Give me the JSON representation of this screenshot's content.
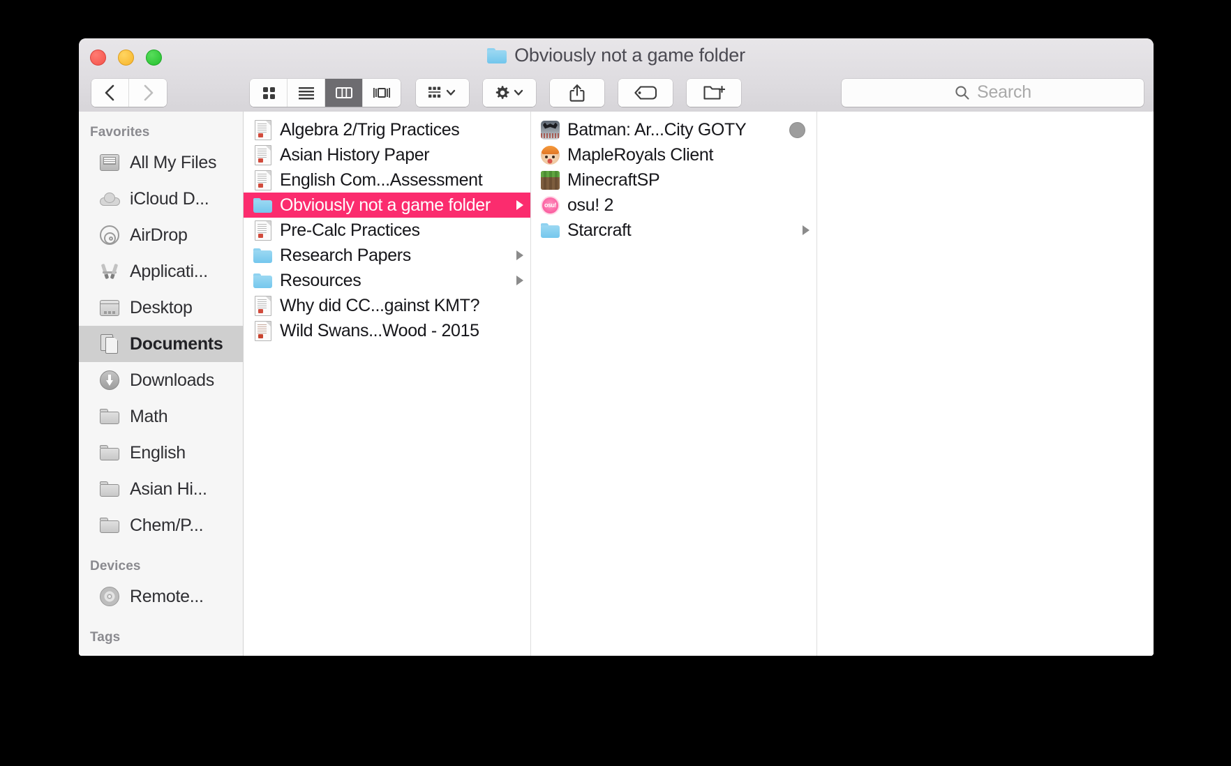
{
  "window": {
    "title": "Obviously not a game folder",
    "traffic_lights": [
      "close",
      "minimize",
      "maximize"
    ]
  },
  "toolbar": {
    "back_label": "Back",
    "forward_label": "Forward",
    "views": [
      {
        "name": "icon-view",
        "label": "Icon View",
        "active": false
      },
      {
        "name": "list-view",
        "label": "List View",
        "active": false
      },
      {
        "name": "column-view",
        "label": "Column View",
        "active": true
      },
      {
        "name": "coverflow-view",
        "label": "Cover Flow View",
        "active": false
      }
    ],
    "arrange_label": "Arrange",
    "action_label": "Action",
    "share_label": "Share",
    "tag_label": "Tag",
    "new_folder_label": "New Folder"
  },
  "search": {
    "placeholder": "Search",
    "value": ""
  },
  "sidebar": {
    "sections": [
      {
        "header": "Favorites",
        "items": [
          {
            "label": "All My Files",
            "icon": "all-my-files-icon",
            "selected": false
          },
          {
            "label": "iCloud D...",
            "icon": "icloud-drive-icon",
            "selected": false
          },
          {
            "label": "AirDrop",
            "icon": "airdrop-icon",
            "selected": false
          },
          {
            "label": "Applicati...",
            "icon": "applications-icon",
            "selected": false
          },
          {
            "label": "Desktop",
            "icon": "desktop-icon",
            "selected": false
          },
          {
            "label": "Documents",
            "icon": "documents-icon",
            "selected": true
          },
          {
            "label": "Downloads",
            "icon": "downloads-icon",
            "selected": false
          },
          {
            "label": "Math",
            "icon": "folder-icon",
            "selected": false
          },
          {
            "label": "English",
            "icon": "folder-icon",
            "selected": false
          },
          {
            "label": "Asian Hi...",
            "icon": "folder-icon",
            "selected": false
          },
          {
            "label": "Chem/P...",
            "icon": "folder-icon",
            "selected": false
          }
        ]
      },
      {
        "header": "Devices",
        "items": [
          {
            "label": "Remote...",
            "icon": "remote-disc-icon",
            "selected": false
          }
        ]
      },
      {
        "header": "Tags",
        "items": []
      }
    ]
  },
  "columns": [
    {
      "name": "documents-column",
      "rows": [
        {
          "label": "Algebra 2/Trig Practices",
          "icon": "document-icon",
          "kind": "doc",
          "selected": false,
          "has_disclosure": false,
          "status_dot": false
        },
        {
          "label": "Asian History Paper",
          "icon": "document-icon",
          "kind": "doc",
          "selected": false,
          "has_disclosure": false,
          "status_dot": false
        },
        {
          "label": "English Com...Assessment",
          "icon": "document-icon",
          "kind": "doc",
          "selected": false,
          "has_disclosure": false,
          "status_dot": false
        },
        {
          "label": "Obviously not a game folder",
          "icon": "folder-icon",
          "kind": "folder",
          "selected": true,
          "has_disclosure": true,
          "status_dot": false
        },
        {
          "label": "Pre-Calc Practices",
          "icon": "document-icon",
          "kind": "doc",
          "selected": false,
          "has_disclosure": false,
          "status_dot": false
        },
        {
          "label": "Research Papers",
          "icon": "folder-icon",
          "kind": "folder",
          "selected": false,
          "has_disclosure": true,
          "status_dot": false
        },
        {
          "label": "Resources",
          "icon": "folder-icon",
          "kind": "folder",
          "selected": false,
          "has_disclosure": true,
          "status_dot": false
        },
        {
          "label": "Why did CC...gainst KMT?",
          "icon": "document-icon",
          "kind": "doc",
          "selected": false,
          "has_disclosure": false,
          "status_dot": false
        },
        {
          "label": "Wild Swans...Wood - 2015",
          "icon": "pdf-icon",
          "kind": "pdf",
          "selected": false,
          "has_disclosure": false,
          "status_dot": false
        }
      ]
    },
    {
      "name": "game-folder-column",
      "rows": [
        {
          "label": "Batman: Ar...City GOTY",
          "icon": "batman-app-icon",
          "kind": "batman",
          "selected": false,
          "has_disclosure": false,
          "status_dot": true
        },
        {
          "label": "MapleRoyals Client",
          "icon": "mapleroyals-app-icon",
          "kind": "maple",
          "selected": false,
          "has_disclosure": false,
          "status_dot": false
        },
        {
          "label": "MinecraftSP",
          "icon": "minecraft-app-icon",
          "kind": "minecraft",
          "selected": false,
          "has_disclosure": false,
          "status_dot": false
        },
        {
          "label": "osu! 2",
          "icon": "osu-app-icon",
          "kind": "osu",
          "selected": false,
          "has_disclosure": false,
          "status_dot": false
        },
        {
          "label": "Starcraft",
          "icon": "folder-icon",
          "kind": "folder",
          "selected": false,
          "has_disclosure": true,
          "status_dot": false
        }
      ]
    },
    {
      "name": "preview-column",
      "rows": []
    }
  ],
  "colors": {
    "selection_pink": "#fb2c6e",
    "folder_blue": "#74c7ed",
    "sidebar_bg": "#f6f6f6",
    "sidebar_selected": "#cfcfcf",
    "toolbar_active": "#6d6c70"
  }
}
